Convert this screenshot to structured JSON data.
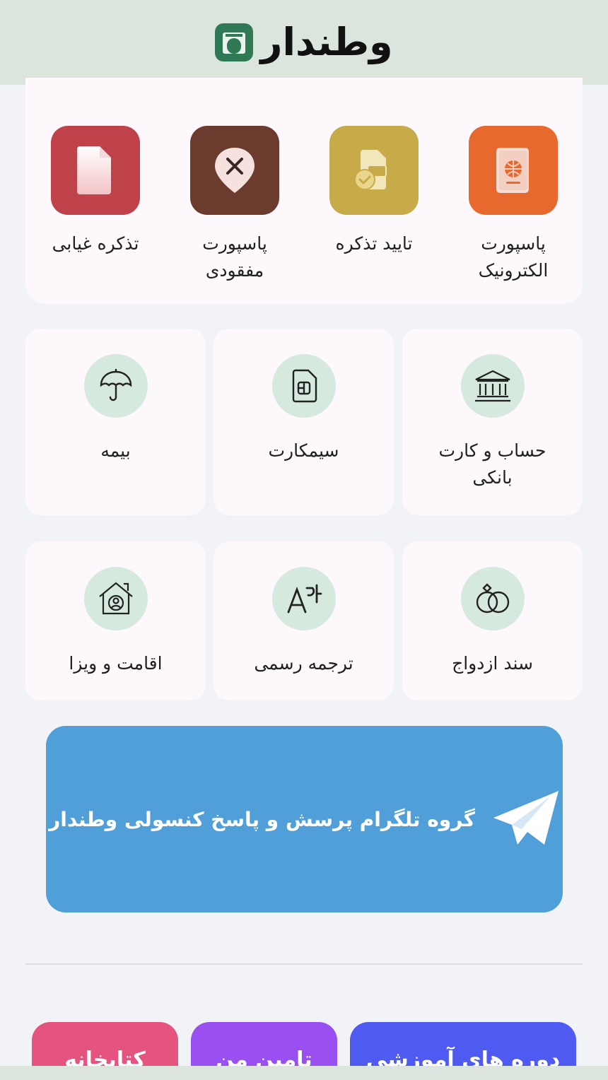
{
  "header": {
    "logo_text": "وطندار"
  },
  "top_services": [
    {
      "label": "پاسپورت\nالکترونیک",
      "icon": "passport-icon",
      "color": "#e8692e"
    },
    {
      "label": "تایید تذکره",
      "icon": "verified-document-icon",
      "color": "#c6ab48"
    },
    {
      "label": "پاسپورت\nمفقودی",
      "icon": "lost-location-icon",
      "color": "#6b3b2e"
    },
    {
      "label": "تذکره غیابی",
      "icon": "file-icon",
      "color": "#bf424a"
    }
  ],
  "services": [
    {
      "label": "حساب و کارت بانکی",
      "icon": "bank-icon"
    },
    {
      "label": "سیمکارت",
      "icon": "sim-card-icon"
    },
    {
      "label": "بیمه",
      "icon": "umbrella-icon"
    },
    {
      "label": "سند ازدواج",
      "icon": "rings-icon"
    },
    {
      "label": "ترجمه رسمی",
      "icon": "translate-icon"
    },
    {
      "label": "اقامت و ویزا",
      "icon": "home-user-icon"
    }
  ],
  "telegram": {
    "label": "گروه تلگرام پرسش و پاسخ کنسولی وطندار",
    "icon": "telegram-icon",
    "color": "#519fd8"
  },
  "bottom_buttons": [
    {
      "label": "دوره های آموزشی",
      "color": "#4e5af0"
    },
    {
      "label": "تامین من",
      "color": "#9a4ff0"
    },
    {
      "label": "کتابخانه",
      "color": "#e4547e"
    }
  ]
}
